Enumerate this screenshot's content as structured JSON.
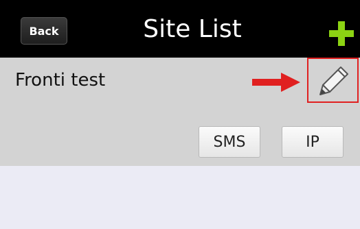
{
  "header": {
    "back_label": "Back",
    "title": "Site List"
  },
  "site": {
    "name": "Fronti test",
    "sms_label": "SMS",
    "ip_label": "IP"
  },
  "colors": {
    "header_bg": "#000000",
    "add_icon": "#8cd313",
    "row_bg": "#d3d3d3",
    "highlight": "#e02020",
    "list_bg": "#ebebf5"
  },
  "icons": {
    "add": "plus-icon",
    "edit": "pencil-icon",
    "annotation": "arrow-right-icon"
  }
}
